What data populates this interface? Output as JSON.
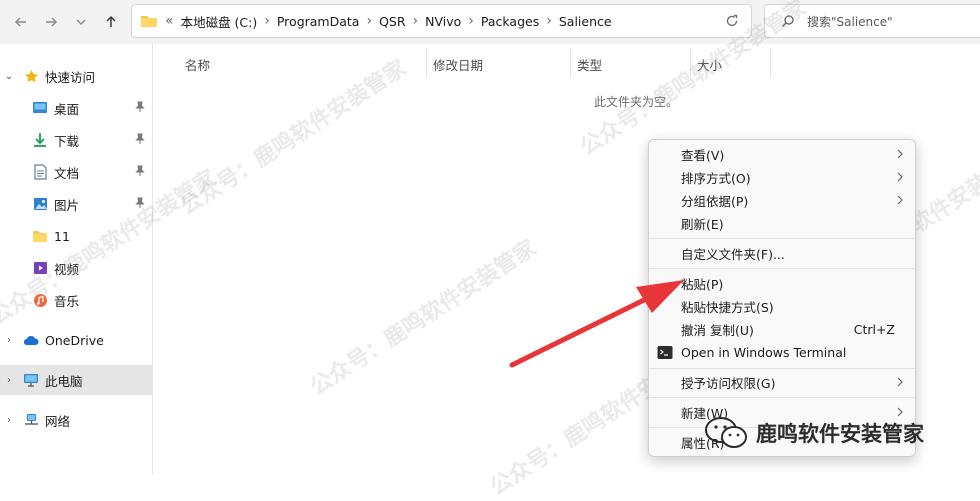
{
  "address": {
    "overflow": "«",
    "crumbs": [
      "本地磁盘 (C:)",
      "ProgramData",
      "QSR",
      "NVivo",
      "Packages",
      "Salience"
    ]
  },
  "search": {
    "placeholder": "搜索\"Salience\""
  },
  "sidebar": {
    "quick_access": "快速访问",
    "items": [
      {
        "label": "桌面",
        "icon": "desktop-icon",
        "pinned": true
      },
      {
        "label": "下载",
        "icon": "download-icon",
        "pinned": true
      },
      {
        "label": "文档",
        "icon": "document-icon",
        "pinned": true
      },
      {
        "label": "图片",
        "icon": "pictures-icon",
        "pinned": true
      },
      {
        "label": "11",
        "icon": "folder-icon",
        "pinned": false
      },
      {
        "label": "视频",
        "icon": "video-icon",
        "pinned": false
      },
      {
        "label": "音乐",
        "icon": "music-icon",
        "pinned": false
      }
    ],
    "onedrive": "OneDrive",
    "this_pc": "此电脑",
    "network": "网络"
  },
  "columns": {
    "name": "名称",
    "modified": "修改日期",
    "type": "类型",
    "size": "大小"
  },
  "empty_message": "此文件夹为空。",
  "context_menu": {
    "view": "查看(V)",
    "sort": "排序方式(O)",
    "group": "分组依据(P)",
    "refresh": "刷新(E)",
    "customize": "自定义文件夹(F)...",
    "paste": "粘贴(P)",
    "paste_shortcut": "粘贴快捷方式(S)",
    "undo_copy": "撤消 复制(U)",
    "undo_shortcut": "Ctrl+Z",
    "terminal": "Open in Windows Terminal",
    "access": "授予访问权限(G)",
    "new": "新建(W)",
    "properties": "属性(R)"
  },
  "watermark": {
    "text": "公众号：鹿鸣软件安装管家",
    "logo_text": "鹿鸣软件安装管家"
  },
  "colors": {
    "accent_red": "#e8353a",
    "folder_yellow": "#f5c64b",
    "onedrive_blue": "#1f6fd1",
    "selected_bg": "#e5e5e5"
  }
}
